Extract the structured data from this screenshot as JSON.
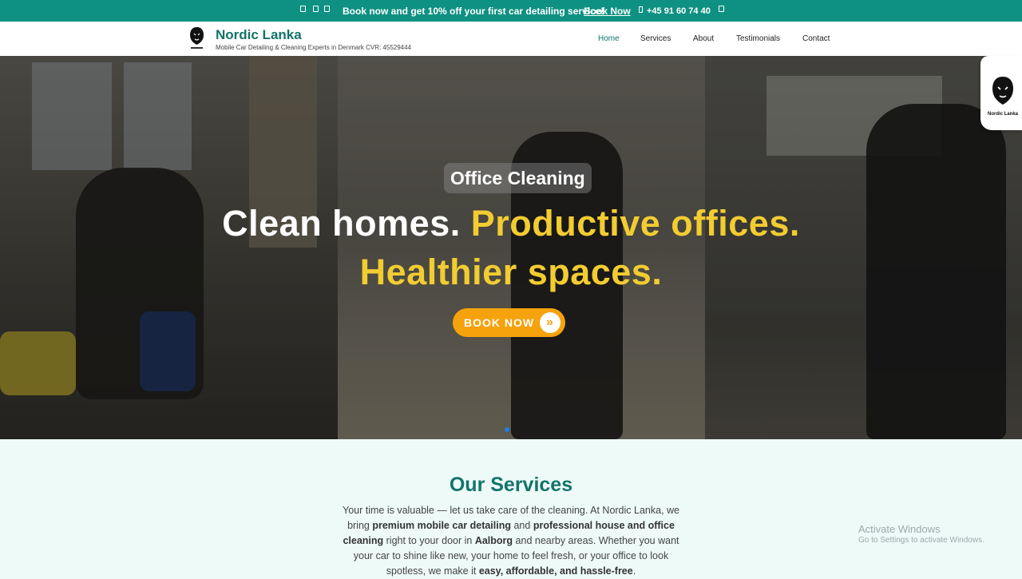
{
  "topbar": {
    "promo_text": "Book now and get 10% off your first car detailing service!",
    "book_link": "Book Now",
    "phone": "+45 91 60 74 40",
    "social_icons": [
      "social-icon",
      "social-icon",
      "social-icon"
    ],
    "bg_color": "#0e9182"
  },
  "header": {
    "brand": "Nordic Lanka",
    "tagline": "Mobile Car Detailing & Cleaning Experts in Denmark CVR: 45529444",
    "nav": [
      "Home",
      "Services",
      "About",
      "Testimonials",
      "Contact"
    ],
    "active_nav": "Home",
    "brand_color": "#137468"
  },
  "hero": {
    "tag": "Office Cleaning",
    "headline_white": "Clean homes.",
    "headline_yellow": "Productive offices.",
    "headline_line2": "Healthier spaces.",
    "button_label": "BOOK NOW",
    "accent_yellow": "#f2cc31",
    "button_color": "#f6a20d"
  },
  "float_logo": {
    "text": "Nordic Lanka"
  },
  "services": {
    "title": "Our Services",
    "intro_parts": [
      "Your time is valuable — let us take care of the cleaning. At Nordic Lanka, we bring ",
      "premium mobile car detailing",
      " and ",
      "professional house and office cleaning",
      " right to your door in ",
      "Aalborg",
      " and nearby areas. Whether you want your car to shine like new, your home to feel fresh, or your office to look spotless, we make it ",
      "easy, affordable, and hassle-free",
      "."
    ]
  },
  "watermark": {
    "title": "Activate Windows",
    "subtitle": "Go to Settings to activate Windows."
  }
}
